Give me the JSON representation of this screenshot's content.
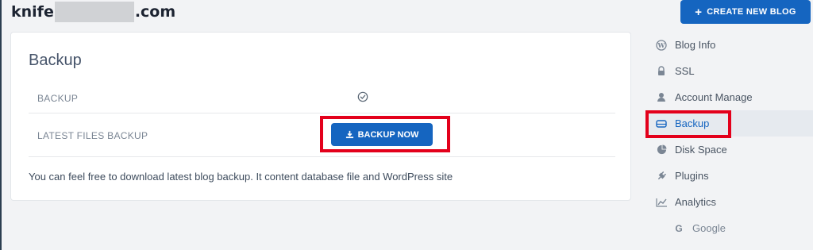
{
  "header": {
    "site_prefix": "knife",
    "site_suffix": ".com",
    "create_button": "CREATE NEW BLOG"
  },
  "card": {
    "title": "Backup",
    "row_backup_label": "BACKUP",
    "row_latest_label": "LATEST FILES BACKUP",
    "backup_now_label": "BACKUP NOW",
    "note": "You can feel free to download latest blog backup. It content database file and WordPress site"
  },
  "sidebar": {
    "items": [
      {
        "label": "Blog Info",
        "icon": "wordpress-icon"
      },
      {
        "label": "SSL",
        "icon": "lock-icon"
      },
      {
        "label": "Account Manage",
        "icon": "user-icon"
      },
      {
        "label": "Backup",
        "icon": "hard-drive-icon",
        "active": true
      },
      {
        "label": "Disk Space",
        "icon": "pie-chart-icon"
      },
      {
        "label": "Plugins",
        "icon": "plug-icon"
      },
      {
        "label": "Analytics",
        "icon": "line-chart-icon"
      },
      {
        "label": "Google",
        "icon": "google-icon"
      }
    ]
  },
  "colors": {
    "primary": "#1565c0",
    "highlight": "#e3001b",
    "active_bg": "#e6eaef"
  }
}
